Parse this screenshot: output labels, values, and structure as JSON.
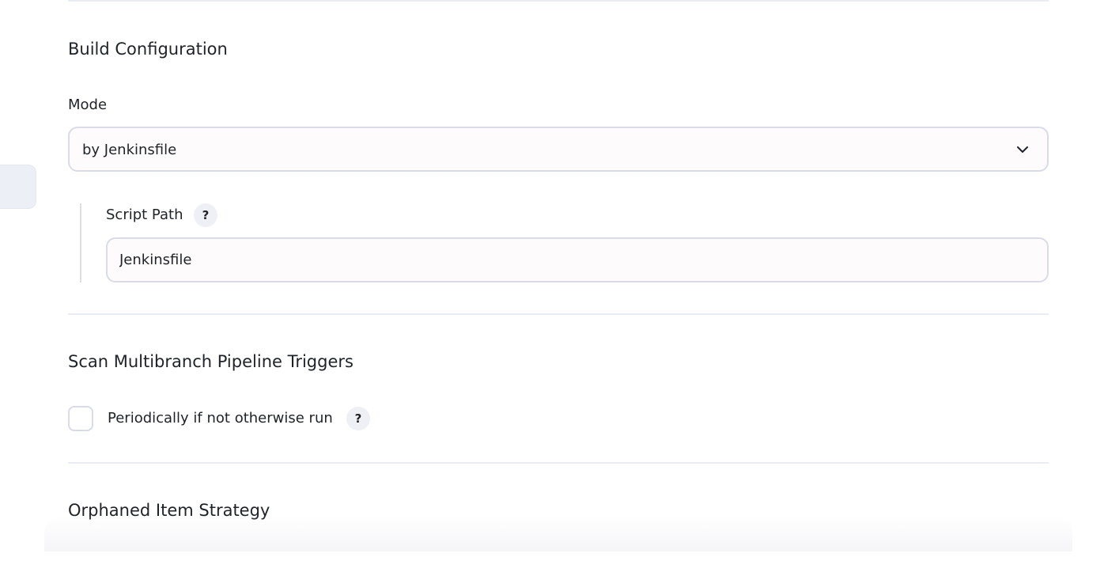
{
  "build_configuration": {
    "title": "Build Configuration",
    "mode_label": "Mode",
    "mode_value": "by Jenkinsfile",
    "script_path_label": "Script Path",
    "script_path_help": "?",
    "script_path_value": "Jenkinsfile"
  },
  "scan_triggers": {
    "title": "Scan Multibranch Pipeline Triggers",
    "periodic_label": "Periodically if not otherwise run",
    "periodic_help": "?",
    "periodic_checked": false
  },
  "orphaned_strategy": {
    "title": "Orphaned Item Strategy"
  },
  "icons": {
    "mode_dropdown": "chevron-down-icon"
  },
  "colors": {
    "border": "#d9dbe8",
    "divider": "#e9ecf1",
    "help_bg": "#eef0f5",
    "sidebar_tab": "#eceff6"
  }
}
